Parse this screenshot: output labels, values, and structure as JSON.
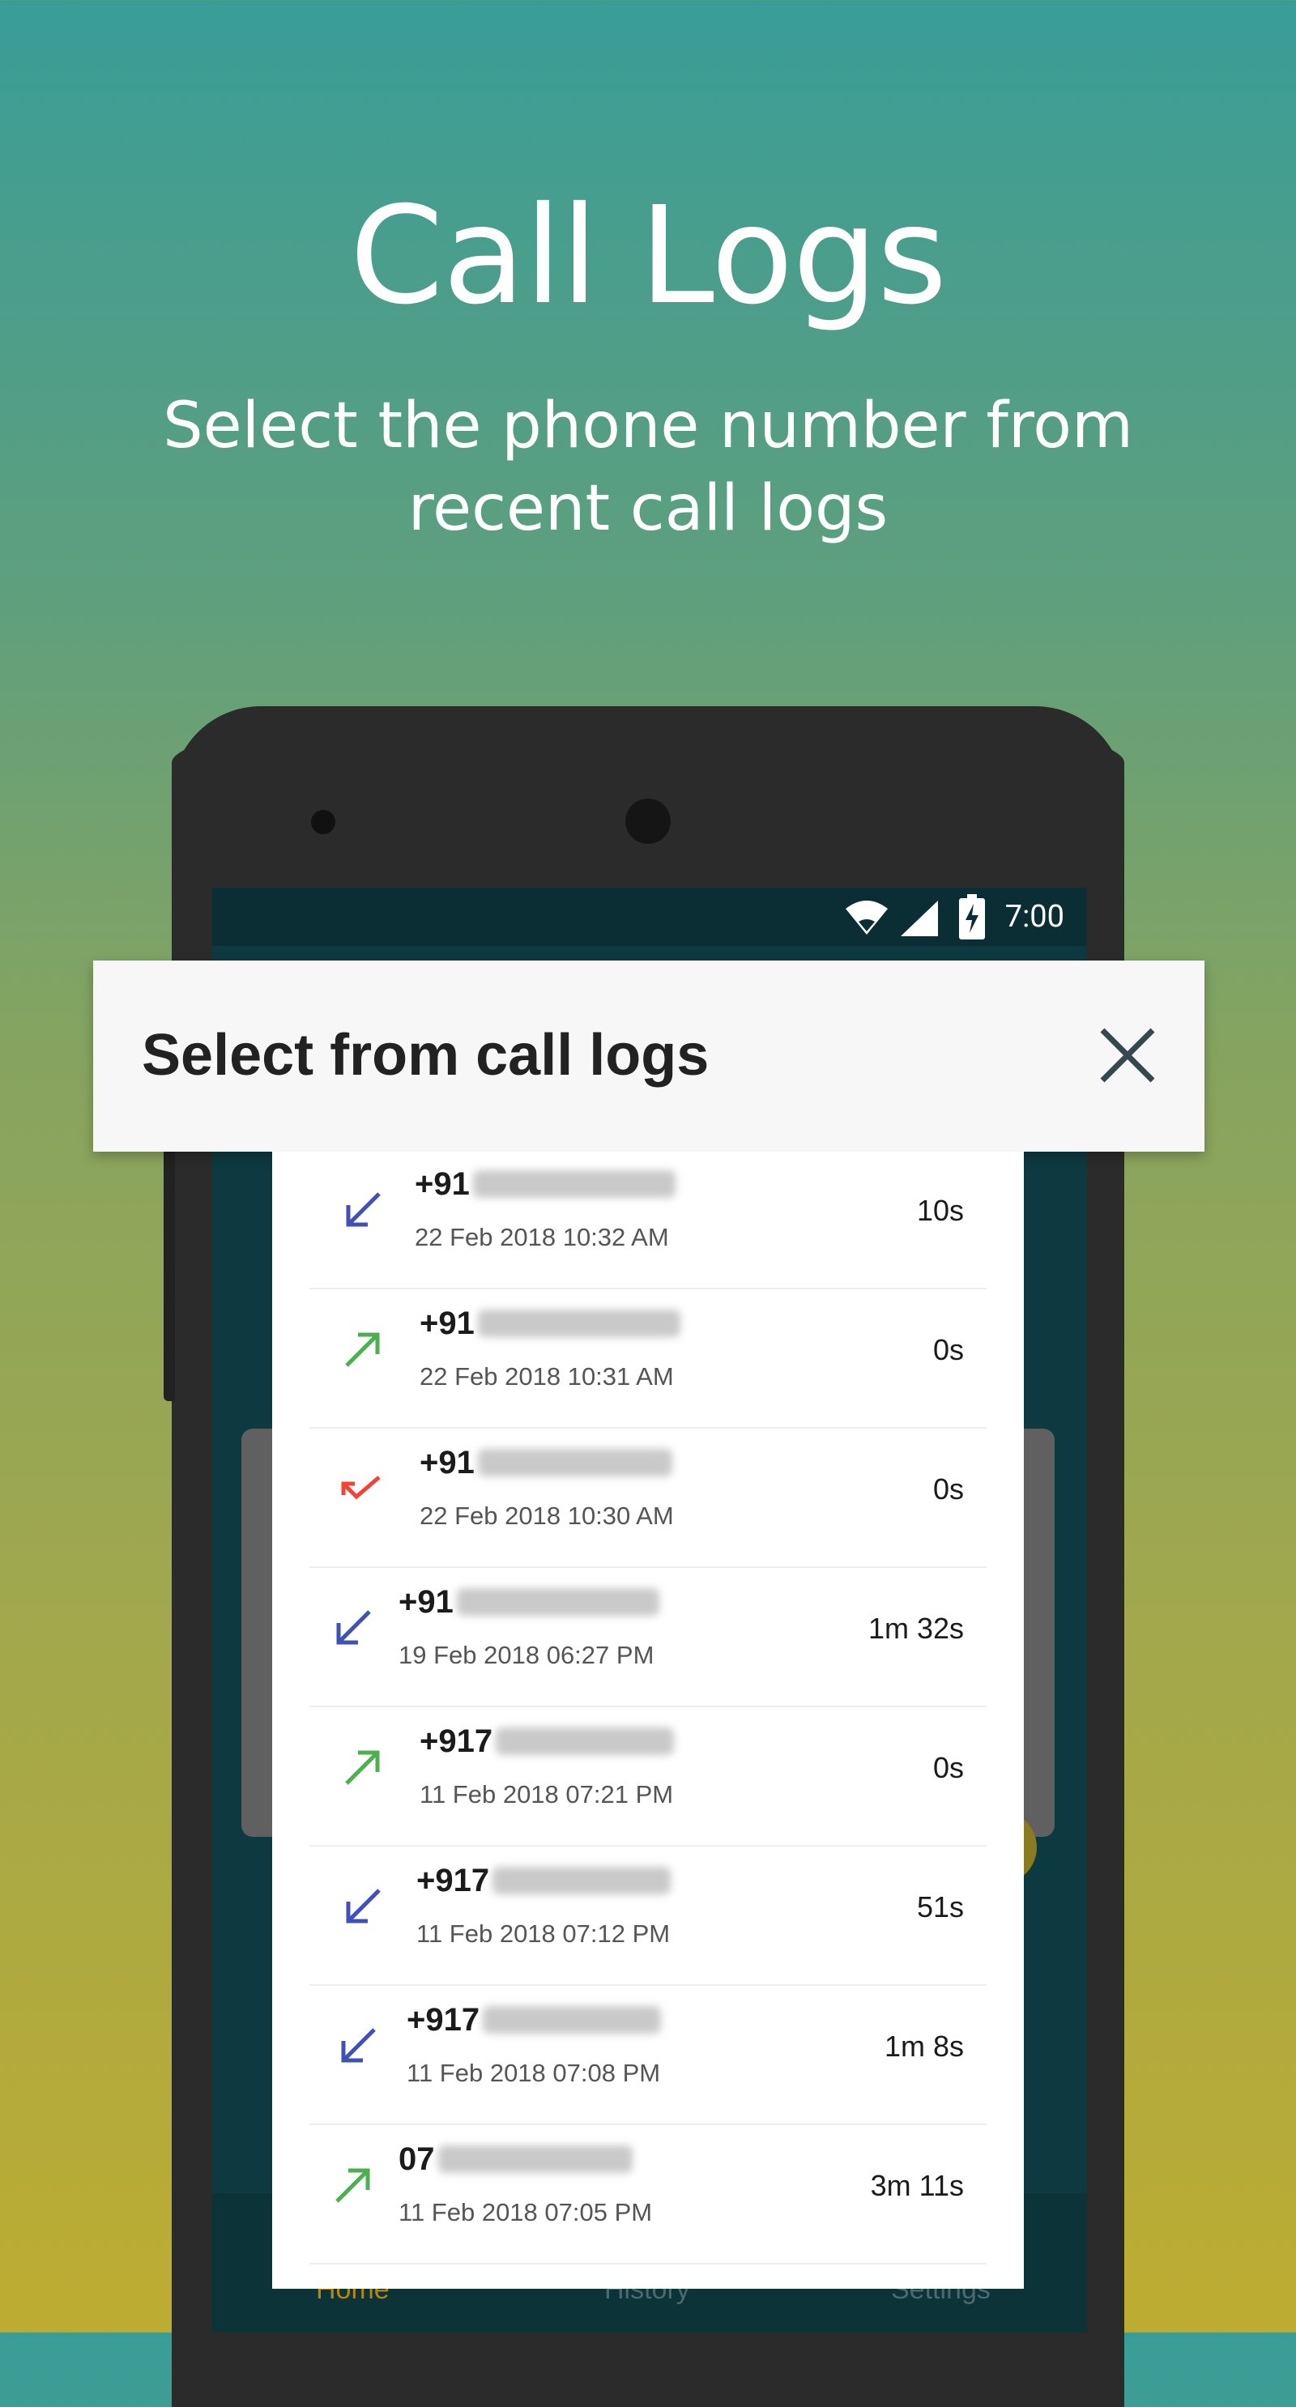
{
  "promo": {
    "headline": "Call Logs",
    "subtitle": "Select the phone number from recent call logs"
  },
  "status_bar": {
    "time": "7:00",
    "icons": [
      "wifi-icon",
      "signal-icon",
      "battery-charging-icon"
    ]
  },
  "dialog": {
    "title": "Select from call logs",
    "close_icon": "close-icon"
  },
  "bottom_nav": {
    "items": [
      {
        "label": "Home",
        "color": "#b8860b"
      },
      {
        "label": "History",
        "color": "#4b6a6d"
      },
      {
        "label": "Settings",
        "color": "#4b6a6d"
      }
    ]
  },
  "call_logs": [
    {
      "number_prefix": "+91",
      "date": "22 Feb 2018 10:32 AM",
      "duration": "10s",
      "type": "incoming",
      "icon": "incoming-call-icon"
    },
    {
      "number_prefix": "+91",
      "date": "22 Feb 2018 10:31 AM",
      "duration": "0s",
      "type": "outgoing",
      "icon": "outgoing-call-icon"
    },
    {
      "number_prefix": "+91",
      "date": "22 Feb 2018 10:30 AM",
      "duration": "0s",
      "type": "missed",
      "icon": "missed-call-icon"
    },
    {
      "number_prefix": "+91",
      "date": "19 Feb 2018 06:27 PM",
      "duration": "1m 32s",
      "type": "incoming",
      "icon": "incoming-call-icon"
    },
    {
      "number_prefix": "+917",
      "date": "11 Feb 2018 07:21 PM",
      "duration": "0s",
      "type": "outgoing",
      "icon": "outgoing-call-icon"
    },
    {
      "number_prefix": "+917",
      "date": "11 Feb 2018 07:12 PM",
      "duration": "51s",
      "type": "incoming",
      "icon": "incoming-call-icon"
    },
    {
      "number_prefix": "+917",
      "date": "11 Feb 2018 07:08 PM",
      "duration": "1m 8s",
      "type": "incoming",
      "icon": "incoming-call-icon"
    },
    {
      "number_prefix": "07",
      "date": "11 Feb 2018 07:05 PM",
      "duration": "3m 11s",
      "type": "outgoing",
      "icon": "outgoing-call-icon"
    }
  ],
  "colors": {
    "incoming": "#3f51b5",
    "outgoing": "#4caf50",
    "missed": "#f44336"
  }
}
